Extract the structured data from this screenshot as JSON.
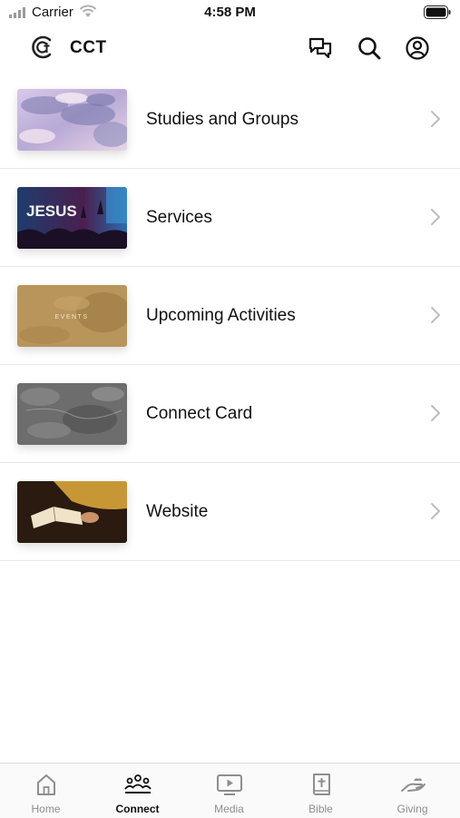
{
  "status_bar": {
    "carrier": "Carrier",
    "time": "4:58 PM"
  },
  "header": {
    "title": "CCT"
  },
  "items": [
    {
      "label": "Studies and Groups",
      "thumb_icon": "clouds-image"
    },
    {
      "label": "Services",
      "thumb_icon": "worship-concert-image",
      "thumb_text": "JESUS"
    },
    {
      "label": "Upcoming Activities",
      "thumb_icon": "events-image",
      "thumb_text": "EVENTS"
    },
    {
      "label": "Connect Card",
      "thumb_icon": "stone-texture-image"
    },
    {
      "label": "Website",
      "thumb_icon": "open-bible-image"
    }
  ],
  "tabs": [
    {
      "label": "Home",
      "icon": "home-icon",
      "active": false
    },
    {
      "label": "Connect",
      "icon": "people-icon",
      "active": true
    },
    {
      "label": "Media",
      "icon": "play-screen-icon",
      "active": false
    },
    {
      "label": "Bible",
      "icon": "bible-icon",
      "active": false
    },
    {
      "label": "Giving",
      "icon": "giving-hand-icon",
      "active": false
    }
  ],
  "colors": {
    "active_tab": "#111111",
    "inactive_tab": "#8e8e8e",
    "divider": "#e9e9e9"
  }
}
